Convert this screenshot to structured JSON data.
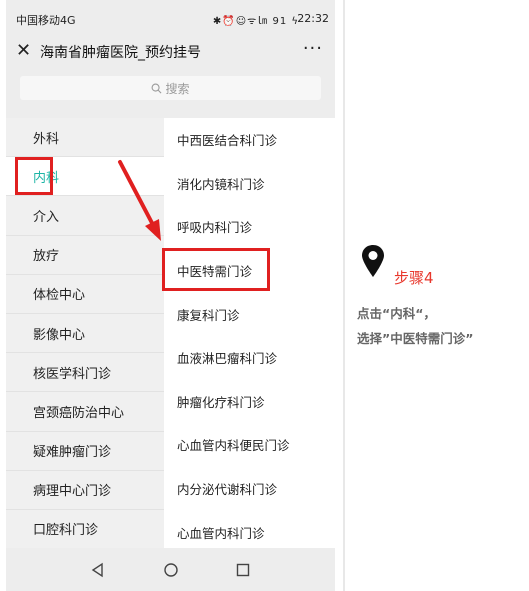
{
  "status_bar": {
    "carrier": "中国移动4G",
    "icons": "✱⏰☺ᯤ㏐ 91 ϟ",
    "time": "22:32"
  },
  "title_bar": {
    "title": "海南省肿瘤医院_预约挂号",
    "more": "···"
  },
  "search": {
    "placeholder": "搜索"
  },
  "departments": [
    {
      "label": "外科",
      "active": false
    },
    {
      "label": "内科",
      "active": true
    },
    {
      "label": "介入",
      "active": false
    },
    {
      "label": "放疗",
      "active": false
    },
    {
      "label": "体检中心",
      "active": false
    },
    {
      "label": "影像中心",
      "active": false
    },
    {
      "label": "核医学科门诊",
      "active": false
    },
    {
      "label": "宫颈癌防治中心",
      "active": false
    },
    {
      "label": "疑难肿瘤门诊",
      "active": false
    },
    {
      "label": "病理中心门诊",
      "active": false
    },
    {
      "label": "口腔科门诊",
      "active": false
    }
  ],
  "clinics": [
    {
      "label": "中西医结合科门诊"
    },
    {
      "label": "消化内镜科门诊"
    },
    {
      "label": "呼吸内科门诊"
    },
    {
      "label": "中医特需门诊"
    },
    {
      "label": "康复科门诊"
    },
    {
      "label": "血液淋巴瘤科门诊"
    },
    {
      "label": "肿瘤化疗科门诊"
    },
    {
      "label": "心血管内科便民门诊"
    },
    {
      "label": "内分泌代谢科门诊"
    },
    {
      "label": "心血管内科门诊"
    }
  ],
  "annotation": {
    "step": "步骤4",
    "line1": "点击“内科“，",
    "line2": "选择”中医特需门诊”",
    "highlight_color": "#e02020",
    "accent_color": "#1fb5a6"
  }
}
